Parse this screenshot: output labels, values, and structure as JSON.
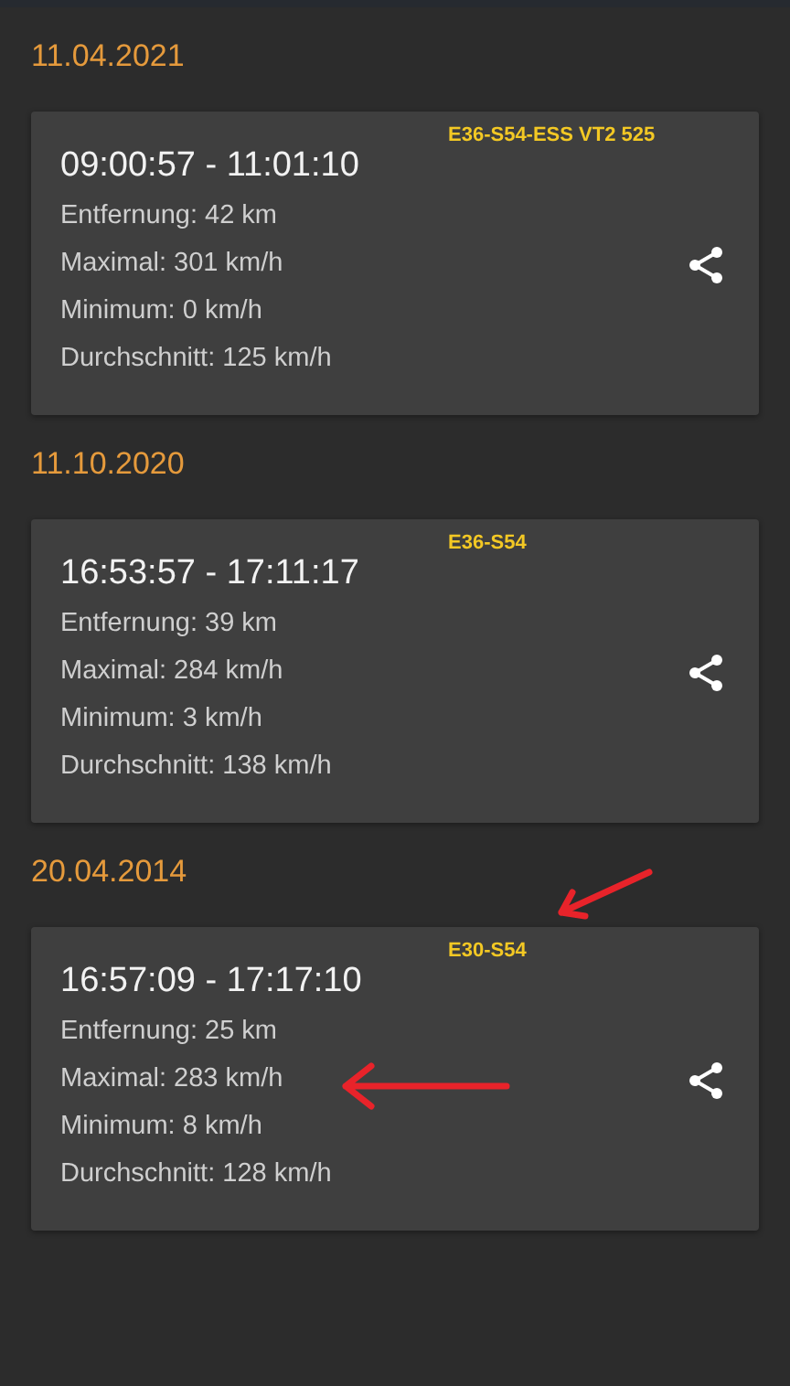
{
  "trips": [
    {
      "date": "11.04.2021",
      "tag": "E36-S54-ESS VT2 525",
      "time": "09:00:57 - 11:01:10",
      "stats": [
        "Entfernung: 42 km",
        "Maximal: 301 km/h",
        "Minimum: 0 km/h",
        "Durchschnitt: 125 km/h"
      ],
      "annotated": false
    },
    {
      "date": "11.10.2020",
      "tag": "E36-S54",
      "time": "16:53:57 - 17:11:17",
      "stats": [
        "Entfernung: 39 km",
        "Maximal: 284 km/h",
        "Minimum: 3 km/h",
        "Durchschnitt: 138 km/h"
      ],
      "annotated": false
    },
    {
      "date": "20.04.2014",
      "tag": "E30-S54",
      "time": "16:57:09 - 17:17:10",
      "stats": [
        "Entfernung: 25 km",
        "Maximal: 283 km/h",
        "Minimum: 8 km/h",
        "Durchschnitt: 128 km/h"
      ],
      "annotated": true
    }
  ]
}
